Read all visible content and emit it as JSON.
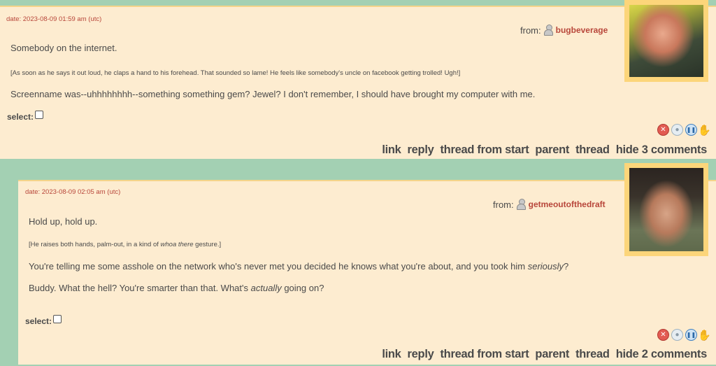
{
  "comments": [
    {
      "date": "date: 2023-08-09 01:59 am (utc)",
      "from_label": "from:",
      "username": "bugbeverage",
      "paragraphs": [
        "Somebody on the internet.",
        "[As soon as he says it out loud, he claps a hand to his forehead. That sounded so lame! He feels like somebody's uncle on facebook getting trolled! Ugh!]",
        "Screenname was--uhhhhhhhh--something something gem? Jewel? I don't remember, I should have brought my computer with me."
      ],
      "select_label": "select:",
      "links": [
        "link",
        "reply",
        "thread from start",
        "parent",
        "thread",
        "hide 3 comments"
      ]
    },
    {
      "date": "date: 2023-08-09 02:05 am (utc)",
      "from_label": "from:",
      "username": "getmeoutofthedraft",
      "p1": "Hold up, hold up.",
      "p2_before": "[He raises both hands, palm-out, in a kind of ",
      "p2_em": "whoa there",
      "p2_after": " gesture.]",
      "p3_before": "You're telling me some asshole on the network who's never met you decided he knows what you're about, and you took him ",
      "p3_em": "seriously",
      "p3_after": "?",
      "p4_before": "Buddy. What the hell? You're smarter than that. What's ",
      "p4_em": "actually",
      "p4_after": " going on?",
      "select_label": "select:",
      "links": [
        "link",
        "reply",
        "thread from start",
        "parent",
        "thread",
        "hide 2 comments"
      ]
    }
  ],
  "icons": [
    "delete-icon",
    "bulb-icon",
    "pause-icon",
    "hand-icon"
  ]
}
